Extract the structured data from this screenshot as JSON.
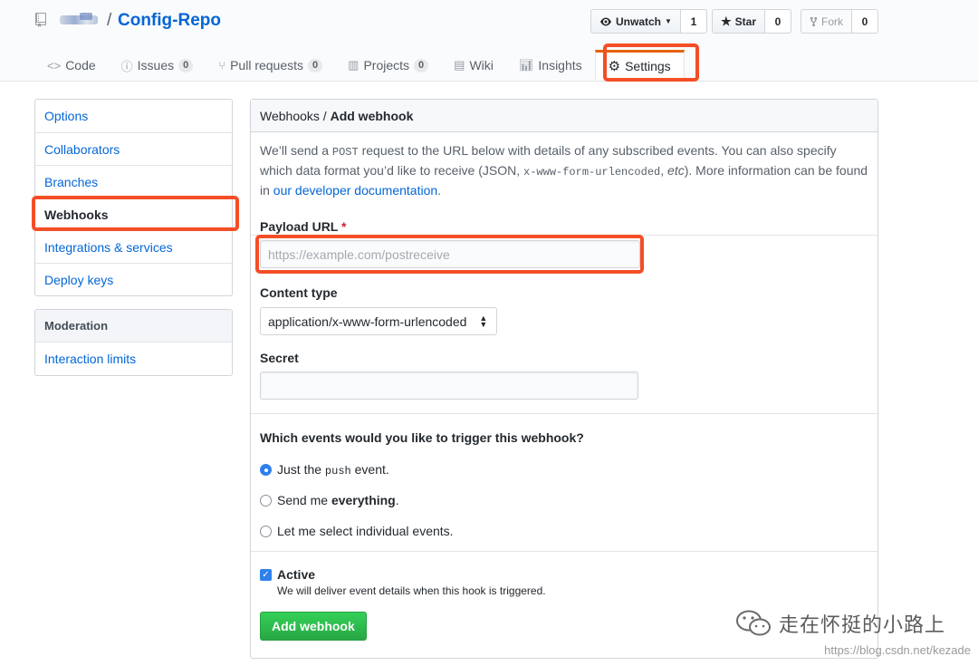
{
  "repo": {
    "name": "Config-Repo",
    "separator": "/"
  },
  "actions": {
    "watch": {
      "label": "Unwatch",
      "count": "1"
    },
    "star": {
      "label": "Star",
      "count": "0"
    },
    "fork": {
      "label": "Fork",
      "count": "0"
    }
  },
  "tabs": [
    {
      "label": "Code",
      "icon": "code-icon"
    },
    {
      "label": "Issues",
      "icon": "issue-icon",
      "count": "0"
    },
    {
      "label": "Pull requests",
      "icon": "pull-request-icon",
      "count": "0"
    },
    {
      "label": "Projects",
      "icon": "project-icon",
      "count": "0"
    },
    {
      "label": "Wiki",
      "icon": "book-icon"
    },
    {
      "label": "Insights",
      "icon": "graph-icon"
    },
    {
      "label": "Settings",
      "icon": "gear-icon",
      "selected": true
    }
  ],
  "sidebar": {
    "items": [
      {
        "label": "Options"
      },
      {
        "label": "Collaborators"
      },
      {
        "label": "Branches"
      },
      {
        "label": "Webhooks",
        "selected": true
      },
      {
        "label": "Integrations & services"
      },
      {
        "label": "Deploy keys"
      }
    ],
    "moderation_heading": "Moderation",
    "moderation_items": [
      {
        "label": "Interaction limits"
      }
    ]
  },
  "form": {
    "breadcrumb_parent": "Webhooks",
    "breadcrumb_sep": " / ",
    "breadcrumb_current": "Add webhook",
    "intro": {
      "p1": "We’ll send a ",
      "post": "POST",
      "p2": " request to the URL below with details of any subscribed events. You can also specify which data format you’d like to receive (JSON, ",
      "urlenc": "x-www-form-urlencoded",
      "p3": ", ",
      "etc": "etc",
      "p4": "). More information can be found in ",
      "link": "our developer documentation",
      "p5": "."
    },
    "payload_label": "Payload URL",
    "required_mark": "*",
    "payload_placeholder": "https://example.com/postreceive",
    "payload_value": "",
    "content_type_label": "Content type",
    "content_type_value": "application/x-www-form-urlencoded",
    "secret_label": "Secret",
    "secret_value": "",
    "events_question": "Which events would you like to trigger this webhook?",
    "event_options": [
      {
        "pre": "Just the ",
        "code": "push",
        "post": " event.",
        "checked": true
      },
      {
        "pre": "Send me ",
        "bold": "everything",
        "post": ".",
        "checked": false
      },
      {
        "label": "Let me select individual events.",
        "checked": false
      }
    ],
    "active_label": "Active",
    "active_checked": true,
    "active_note": "We will deliver event details when this hook is triggered.",
    "submit_label": "Add webhook"
  },
  "watermark": {
    "text": "走在怀挺的小路上",
    "url": "https://blog.csdn.net/kezade"
  },
  "colors": {
    "highlight": "#f44e26",
    "link": "#0366d6",
    "primary": "#28a745",
    "selected_tab_border": "#e36209"
  }
}
